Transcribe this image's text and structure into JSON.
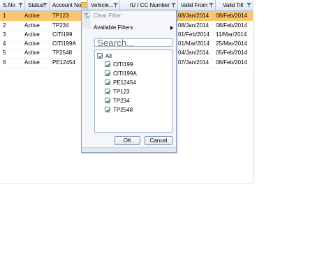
{
  "columns": [
    {
      "label": "S.No"
    },
    {
      "label": "Status"
    },
    {
      "label": "Account No"
    },
    {
      "label": "Vehicle..."
    },
    {
      "label": "IU / CC Number"
    },
    {
      "label": "Valid From"
    },
    {
      "label": "Valid Till"
    }
  ],
  "rows": [
    {
      "sno": "1",
      "status": "Active",
      "account": "TP123",
      "valid_from": "08/Jan/2014",
      "valid_till": "08/Feb/2014"
    },
    {
      "sno": "2",
      "status": "Active",
      "account": "TP234",
      "valid_from": "08/Jan/2014",
      "valid_till": "08/Feb/2014"
    },
    {
      "sno": "3",
      "status": "Active",
      "account": "CITI199",
      "valid_from": "01/Feb/2014",
      "valid_till": "11/Mar/2014"
    },
    {
      "sno": "4",
      "status": "Active",
      "account": "CITI199A",
      "valid_from": "01/Mar/2014",
      "valid_till": "25/Mar/2014"
    },
    {
      "sno": "5",
      "status": "Active",
      "account": "TP2548",
      "valid_from": "04/Jan/2014",
      "valid_till": "05/Feb/2014"
    },
    {
      "sno": "6",
      "status": "Active",
      "account": "PE12454",
      "valid_from": "07/Jan/2014",
      "valid_till": "08/Feb/2014"
    }
  ],
  "selected_row": "1",
  "filter_popup": {
    "clear_filter": "Clear Filter",
    "available_filters": "Available Filters",
    "search_placeholder": "Search...",
    "all_label": "All",
    "items": [
      {
        "label": "CITI199",
        "checked": true
      },
      {
        "label": "CITI199A",
        "checked": true
      },
      {
        "label": "PE12454",
        "checked": true
      },
      {
        "label": "TP123",
        "checked": true
      },
      {
        "label": "TP234",
        "checked": true
      },
      {
        "label": "TP2548",
        "checked": true
      }
    ],
    "ok_label": "OK",
    "cancel_label": "Cancel"
  }
}
